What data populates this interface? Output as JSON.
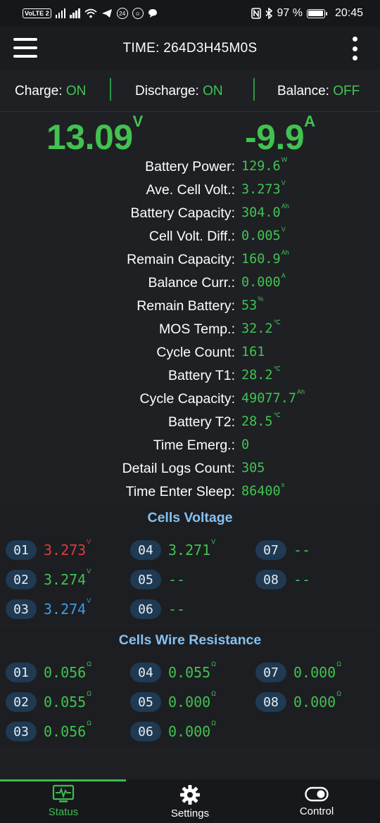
{
  "statusbar": {
    "volte": "VoLTE",
    "sim": "2",
    "notif_badge": "24",
    "battery_pct": "97 %",
    "battery_level": 0.97,
    "clock": "20:45"
  },
  "appbar": {
    "title": "TIME: 264D3H45M0S"
  },
  "switches": {
    "charge_label": "Charge:",
    "charge_state": "ON",
    "discharge_label": "Discharge:",
    "discharge_state": "ON",
    "balance_label": "Balance:",
    "balance_state": "OFF"
  },
  "main": {
    "voltage": "13.09",
    "voltage_unit": "V",
    "current": "-9.9",
    "current_unit": "A"
  },
  "info_rows": [
    {
      "label": "Battery Power:",
      "value": "129.6",
      "unit": "W"
    },
    {
      "label": "Ave. Cell Volt.:",
      "value": "3.273",
      "unit": "V"
    },
    {
      "label": "Battery Capacity:",
      "value": "304.0",
      "unit": "Ah"
    },
    {
      "label": "Cell Volt. Diff.:",
      "value": "0.005",
      "unit": "V"
    },
    {
      "label": "Remain Capacity:",
      "value": "160.9",
      "unit": "Ah"
    },
    {
      "label": "Balance Curr.:",
      "value": "0.000",
      "unit": "A"
    },
    {
      "label": "Remain Battery:",
      "value": "53",
      "unit": "%"
    },
    {
      "label": "MOS Temp.:",
      "value": "32.2",
      "unit": "℃"
    },
    {
      "label": "Cycle Count:",
      "value": "161",
      "unit": ""
    },
    {
      "label": "Battery T1:",
      "value": "28.2",
      "unit": "℃"
    },
    {
      "label": "Cycle Capacity:",
      "value": "49077.7",
      "unit": "Ah"
    },
    {
      "label": "Battery T2:",
      "value": "28.5",
      "unit": "℃"
    },
    {
      "label": "Time Emerg.:",
      "value": "0",
      "unit": ""
    },
    {
      "label": "Detail Logs Count:",
      "value": "305",
      "unit": ""
    },
    {
      "label": "Time Enter Sleep:",
      "value": "86400",
      "unit": "s"
    }
  ],
  "cells_voltage": {
    "title": "Cells Voltage",
    "cells": [
      {
        "id": "01",
        "value": "3.273",
        "unit": "V",
        "color": "#e23b3b"
      },
      {
        "id": "02",
        "value": "3.274",
        "unit": "V",
        "color": "#42c250"
      },
      {
        "id": "03",
        "value": "3.274",
        "unit": "V",
        "color": "#3f9be3"
      },
      {
        "id": "04",
        "value": "3.271",
        "unit": "V",
        "color": "#42c250"
      },
      {
        "id": "05",
        "value": "--",
        "unit": "",
        "color": "#42c250"
      },
      {
        "id": "06",
        "value": "--",
        "unit": "",
        "color": "#42c250"
      },
      {
        "id": "07",
        "value": "--",
        "unit": "",
        "color": "#42c250"
      },
      {
        "id": "08",
        "value": "--",
        "unit": "",
        "color": "#42c250"
      }
    ]
  },
  "cells_resistance": {
    "title": "Cells Wire Resistance",
    "cells": [
      {
        "id": "01",
        "value": "0.056",
        "unit": "Ω"
      },
      {
        "id": "02",
        "value": "0.055",
        "unit": "Ω"
      },
      {
        "id": "03",
        "value": "0.056",
        "unit": "Ω"
      },
      {
        "id": "04",
        "value": "0.055",
        "unit": "Ω"
      },
      {
        "id": "05",
        "value": "0.000",
        "unit": "Ω"
      },
      {
        "id": "06",
        "value": "0.000",
        "unit": "Ω"
      },
      {
        "id": "07",
        "value": "0.000",
        "unit": "Ω"
      },
      {
        "id": "08",
        "value": "0.000",
        "unit": "Ω"
      }
    ]
  },
  "nav": {
    "status_label": "Status",
    "settings_label": "Settings",
    "control_label": "Control",
    "active_color": "#3bbd4d"
  }
}
